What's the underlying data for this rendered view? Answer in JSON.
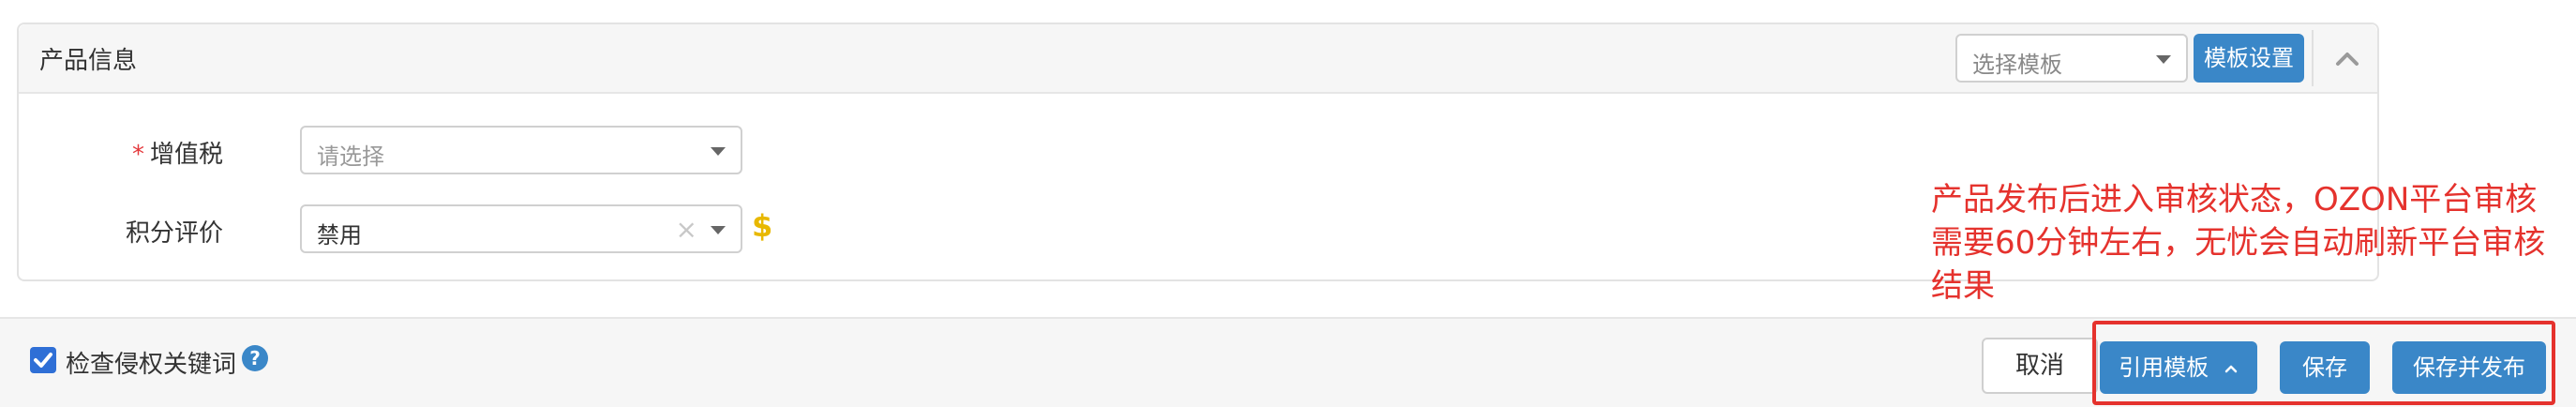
{
  "panel": {
    "title": "产品信息",
    "template_select_placeholder": "选择模板",
    "template_settings_label": "模板设置"
  },
  "form": {
    "vat": {
      "required_mark": "*",
      "label": "增值税",
      "placeholder": "请选择"
    },
    "points_review": {
      "label": "积分评价",
      "value": "禁用",
      "clear_symbol": "×",
      "price_symbol": "$"
    }
  },
  "footer": {
    "check_infringement_label": "检查侵权关键词",
    "check_infringement_checked": true,
    "help_symbol": "?",
    "cancel_label": "取消",
    "use_template_label": "引用模板",
    "save_label": "保存",
    "save_publish_label": "保存并发布"
  },
  "annotation": {
    "lines": [
      "产品发布后进入审核状态，OZON平台审核",
      "需要60分钟左右，无忧会自动刷新平台审核",
      "结果"
    ]
  },
  "colors": {
    "primary": "#3a87c8",
    "annotation_red": "#e5322d",
    "price_yellow": "#e8b800",
    "checkbox_blue": "#2f6fd6"
  },
  "icons": [
    "chevron-up-icon",
    "chevron-down-icon",
    "check-icon",
    "question-circle-icon",
    "dollar-icon",
    "clear-icon"
  ]
}
